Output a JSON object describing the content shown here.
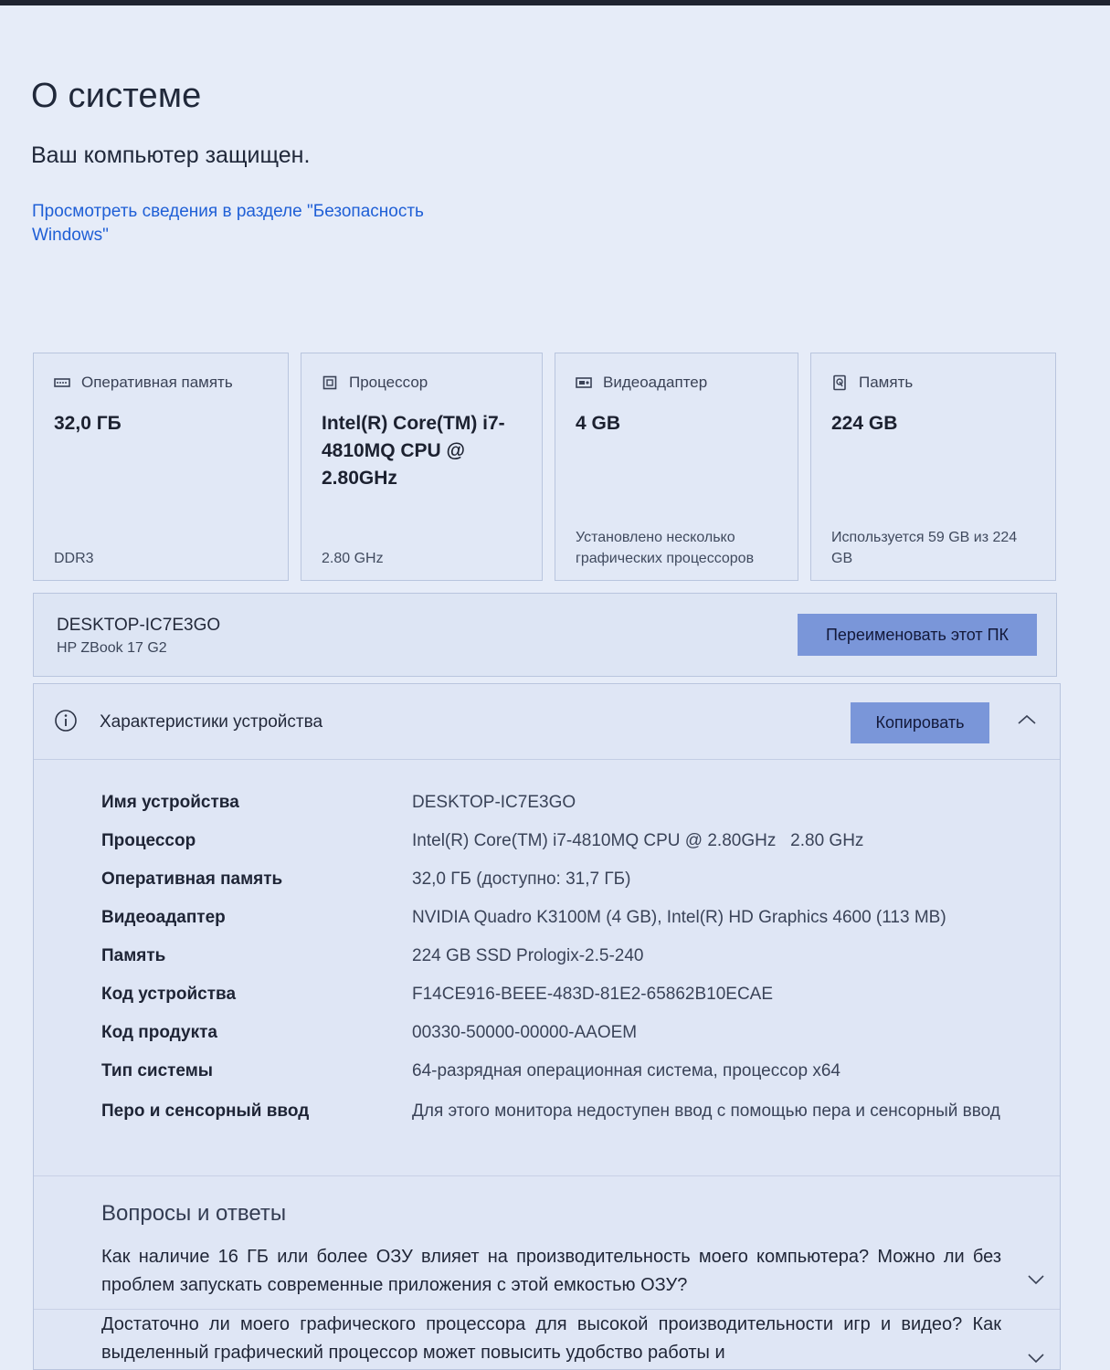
{
  "page": {
    "title": "О системе",
    "protection_status": "Ваш компьютер защищен.",
    "security_link": "Просмотреть сведения в разделе \"Безопасность Windows\""
  },
  "cards": [
    {
      "header": "Оперативная память",
      "icon": "ram-icon",
      "value": "32,0 ГБ",
      "footer": "DDR3"
    },
    {
      "header": "Процессор",
      "icon": "cpu-icon",
      "value": "Intel(R) Core(TM) i7-4810MQ CPU @ 2.80GHz",
      "footer": "2.80 GHz"
    },
    {
      "header": "Видеоадаптер",
      "icon": "gpu-icon",
      "value": "4 GB",
      "footer": "Установлено несколько графических процессоров"
    },
    {
      "header": "Память",
      "icon": "storage-icon",
      "value": "224 GB",
      "footer": "Используется 59 GB из 224 GB"
    }
  ],
  "pc": {
    "name": "DESKTOP-IC7E3GO",
    "model": "HP ZBook 17 G2",
    "rename_label": "Переименовать этот ПК"
  },
  "specs": {
    "title": "Характеристики устройства",
    "copy_label": "Копировать",
    "rows": [
      {
        "label": "Имя устройства",
        "value": "DESKTOP-IC7E3GO"
      },
      {
        "label": "Процессор",
        "value": "Intel(R) Core(TM) i7-4810MQ CPU @ 2.80GHz   2.80 GHz"
      },
      {
        "label": "Оперативная память",
        "value": "32,0 ГБ (доступно: 31,7 ГБ)"
      },
      {
        "label": "Видеоадаптер",
        "value": "NVIDIA Quadro K3100M (4 GB), Intel(R) HD Graphics 4600 (113 MB)"
      },
      {
        "label": "Память",
        "value": "224 GB SSD Prologix-2.5-240"
      },
      {
        "label": "Код устройства",
        "value": "F14CE916-BEEE-483D-81E2-65862B10ECAE"
      },
      {
        "label": "Код продукта",
        "value": "00330-50000-00000-AAOEM"
      },
      {
        "label": "Тип системы",
        "value": "64-разрядная операционная система, процессор x64"
      },
      {
        "label": "Перо и сенсорный ввод",
        "value": "Для этого монитора недоступен ввод с помощью пера и сенсорный ввод"
      }
    ]
  },
  "faq": {
    "title": "Вопросы и ответы",
    "items": [
      "Как наличие 16 ГБ или более ОЗУ влияет на производительность моего компьютера? Можно ли без проблем запускать современные приложения с этой емкостью ОЗУ?",
      "Достаточно ли моего графического процессора для высокой производительности игр и видео? Как выделенный графический процессор может повысить удобство работы и"
    ]
  },
  "colors": {
    "background": "#e6ecf8",
    "link": "#1f5fd6",
    "button": "#7a96d9"
  }
}
